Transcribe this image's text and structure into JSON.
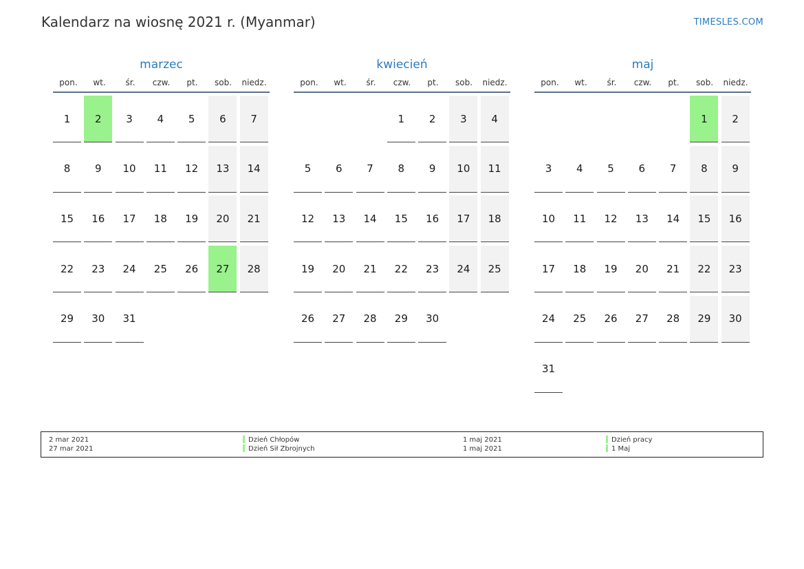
{
  "header": {
    "title": "Kalendarz na wiosnę 2021 r. (Myanmar)",
    "brand": "TIMESLES.COM"
  },
  "weekdays": [
    "pon.",
    "wt.",
    "śr.",
    "czw.",
    "pt.",
    "sob.",
    "niedz."
  ],
  "colors": {
    "holiday": "#99f28c",
    "weekend": "#f2f2f2",
    "accent": "#2b7bbd"
  },
  "months": [
    {
      "name": "marzec",
      "offset": 0,
      "days": 31,
      "holidays": [
        2,
        27
      ]
    },
    {
      "name": "kwiecień",
      "offset": 3,
      "days": 30,
      "holidays": []
    },
    {
      "name": "maj",
      "offset": 5,
      "days": 31,
      "holidays": [
        1
      ]
    }
  ],
  "legend": [
    {
      "date": "2 mar 2021",
      "name": "Dzień Chłopów"
    },
    {
      "date": "27 mar 2021",
      "name": "Dzień Sił Zbrojnych"
    },
    {
      "date": "1 maj 2021",
      "name": "Dzień pracy"
    },
    {
      "date": "1 maj 2021",
      "name": "1 Maj"
    }
  ]
}
